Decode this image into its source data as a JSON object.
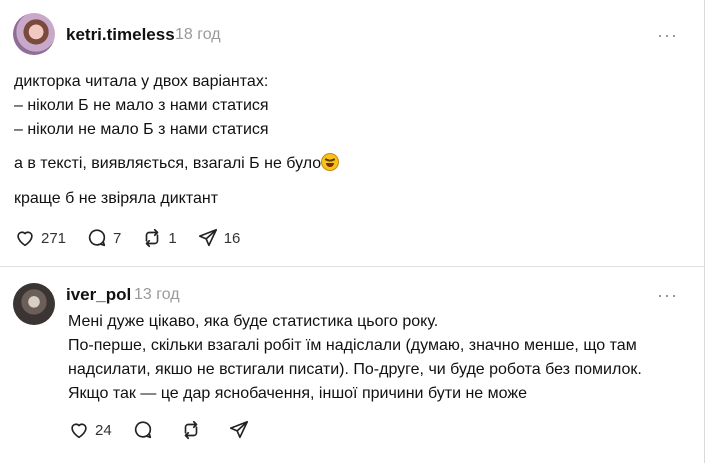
{
  "post1": {
    "username": "ketri.timeless",
    "time": "18 год",
    "more": "···",
    "lines": [
      "дикторка читала у двох варіантах:",
      "– ніколи Б не мало з нами статися",
      "– ніколи не мало Б з нами статися",
      "а в тексті, виявляється, взагалі Б не було",
      "краще б не звіряла диктант"
    ],
    "emoji": "laughing-squint-emoji",
    "likes": "271",
    "comments": "7",
    "reposts": "1",
    "shares": "16"
  },
  "post2": {
    "username": "iver_pol",
    "time": "13 год",
    "more": "···",
    "lines": [
      "Мені дуже цікаво, яка буде статистика цього року.",
      "По-перше, скільки взагалі робіт їм надіслали (думаю, значно менше, що там",
      "надсилати, якшо не встигали писати). По-друге, чи буде робота без помилок.",
      "Якщо так — це дар яснобачення, іншої причини бути не може"
    ],
    "likes": "24"
  }
}
